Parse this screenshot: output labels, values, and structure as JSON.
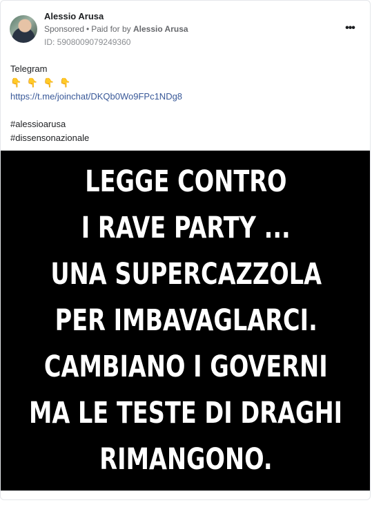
{
  "ad": {
    "author": "Alessio Arusa",
    "sponsored_label": "Sponsored",
    "separator": "•",
    "paid_for_by_prefix": "Paid for by",
    "paid_for_by_name": "Alessio Arusa",
    "ad_id": "ID: 5908009079249360",
    "more_label": "•••"
  },
  "text": {
    "line1": "Telegram",
    "emojis": "👇 👇 👇 👇",
    "link": "https://t.me/joinchat/DKQb0Wo9FPc1NDg8",
    "hashtag1": "#alessioarusa",
    "hashtag2": "#dissensonazionale"
  },
  "creative": {
    "lines": [
      "LEGGE CONTRO",
      "I RAVE PARTY ...",
      "UNA SUPERCAZZOLA",
      "PER IMBAVAGLARCI.",
      "CAMBIANO I GOVERNI",
      "MA LE TESTE DI DRAGHI",
      "RIMANGONO."
    ]
  },
  "icons": {
    "avatar": "profile-photo",
    "more": "more-options-icon"
  },
  "colors": {
    "link": "#385898",
    "creative_bg": "#000000",
    "creative_text": "#ffffff"
  }
}
